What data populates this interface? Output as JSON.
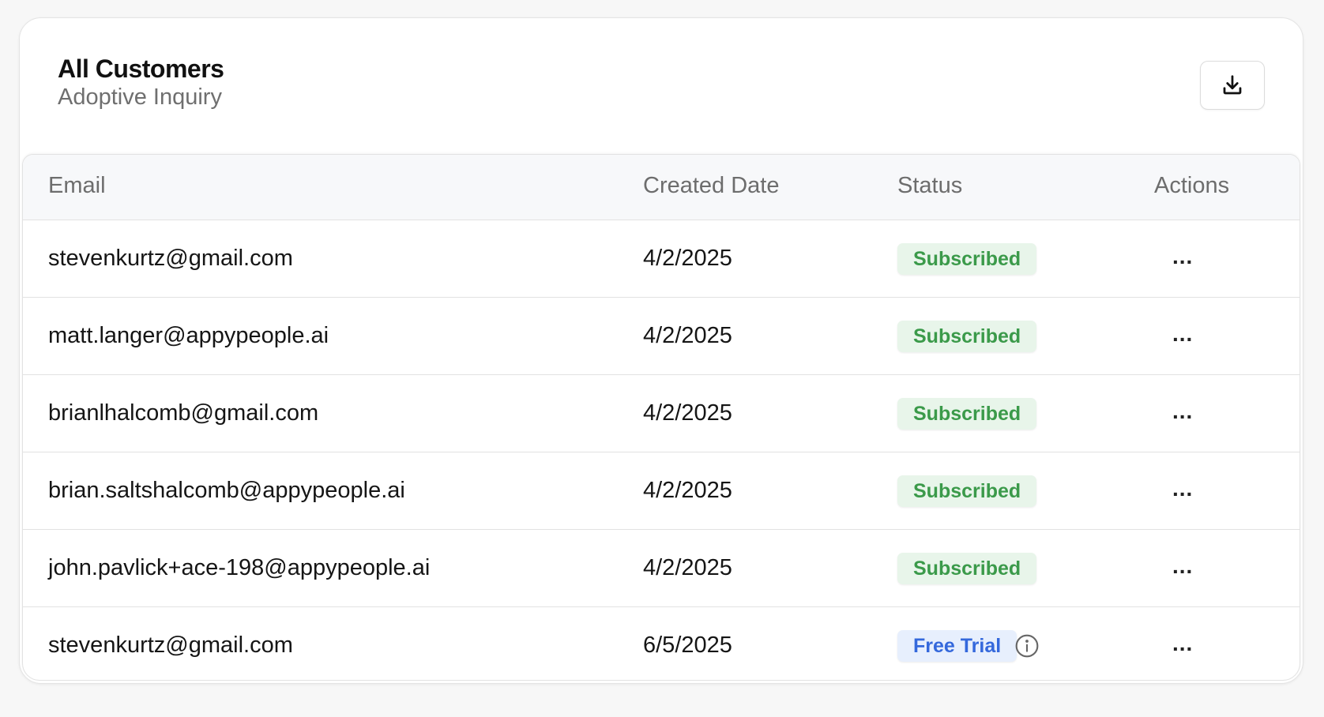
{
  "header": {
    "title": "All Customers",
    "subtitle": "Adoptive Inquiry",
    "download_icon": "download-icon"
  },
  "table": {
    "columns": [
      "Email",
      "Created Date",
      "Status",
      "Actions"
    ],
    "rows": [
      {
        "email": "stevenkurtz@gmail.com",
        "created": "4/2/2025",
        "status": "Subscribed",
        "actions": "..."
      },
      {
        "email": "matt.langer@appypeople.ai",
        "created": "4/2/2025",
        "status": "Subscribed",
        "actions": "..."
      },
      {
        "email": "brianlhalcomb@gmail.com",
        "created": "4/2/2025",
        "status": "Subscribed",
        "actions": "..."
      },
      {
        "email": "brian.saltshalcomb@appypeople.ai",
        "created": "4/2/2025",
        "status": "Subscribed",
        "actions": "..."
      },
      {
        "email": "john.pavlick+ace-198@appypeople.ai",
        "created": "4/2/2025",
        "status": "Subscribed",
        "actions": "..."
      },
      {
        "email": "stevenkurtz@gmail.com",
        "created": "6/5/2025",
        "status": "Free Trial",
        "actions": "..."
      }
    ]
  },
  "colors": {
    "subscribed_bg": "#e8f5ea",
    "subscribed_text": "#3b9a4a",
    "trial_bg": "#e7effd",
    "trial_text": "#3468dc"
  }
}
